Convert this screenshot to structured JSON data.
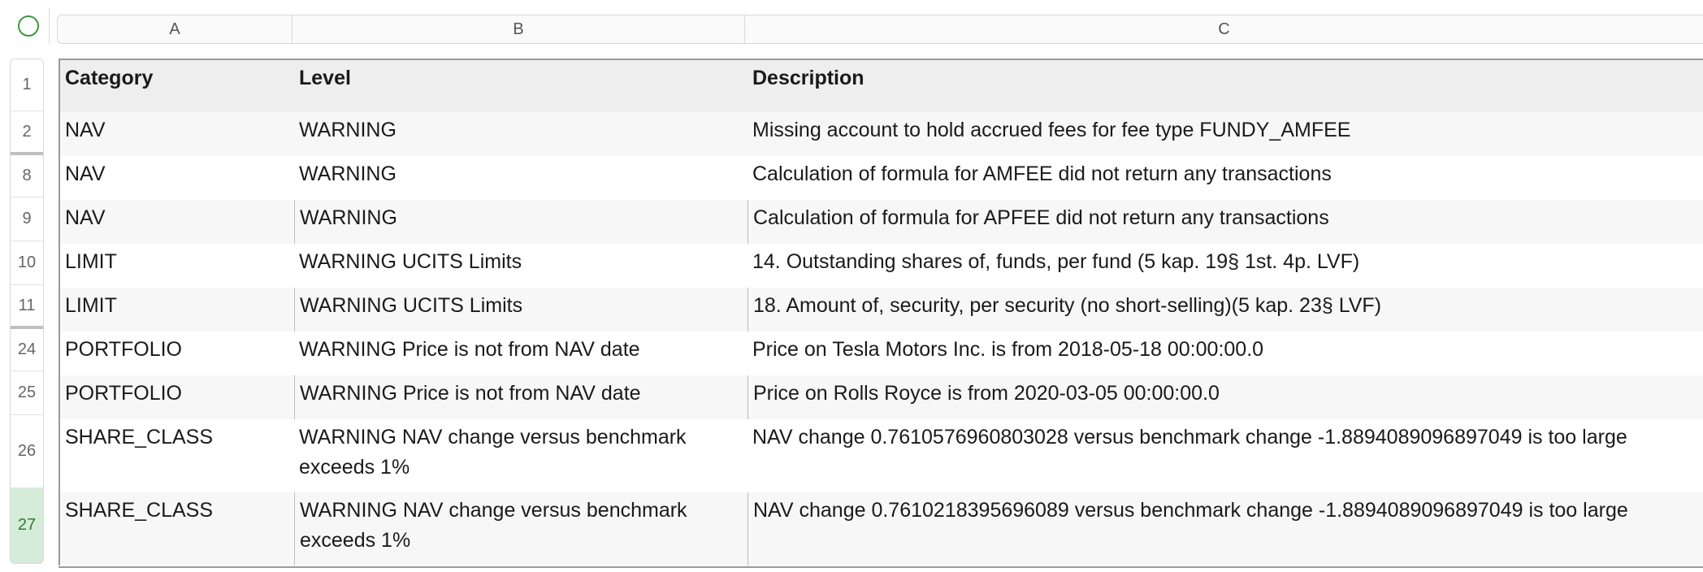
{
  "columns": [
    "A",
    "B",
    "C"
  ],
  "row_numbers": [
    "1",
    "2",
    "8",
    "9",
    "10",
    "11",
    "24",
    "25",
    "26",
    "27"
  ],
  "header": {
    "category": "Category",
    "level": "Level",
    "description": "Description"
  },
  "rows": [
    {
      "category": "NAV",
      "level": "WARNING",
      "description": "Missing account to hold accrued fees for fee type FUNDY_AMFEE"
    },
    {
      "category": "NAV",
      "level": "WARNING",
      "description": "Calculation of formula for AMFEE did not return any transactions"
    },
    {
      "category": "NAV",
      "level": "WARNING",
      "description": "Calculation of formula for APFEE did not return any transactions"
    },
    {
      "category": "LIMIT",
      "level": "WARNING UCITS Limits",
      "description": "14. Outstanding shares of, funds, per fund (5 kap. 19§ 1st. 4p. LVF)"
    },
    {
      "category": "LIMIT",
      "level": "WARNING UCITS Limits",
      "description": "18. Amount of, security, per security (no short-selling)(5 kap. 23§ LVF)"
    },
    {
      "category": "PORTFOLIO",
      "level": "WARNING Price is not from NAV date",
      "description": "Price on Tesla Motors Inc. is from 2018-05-18 00:00:00.0"
    },
    {
      "category": "PORTFOLIO",
      "level": "WARNING Price is not from NAV date",
      "description": "Price on Rolls Royce is from 2020-03-05 00:00:00.0"
    },
    {
      "category": "SHARE_CLASS",
      "level": "WARNING NAV change versus benchmark exceeds 1%",
      "description": "NAV change 0.7610576960803028 versus benchmark change -1.8894089096897049 is too large"
    },
    {
      "category": "SHARE_CLASS",
      "level": "WARNING NAV change versus benchmark exceeds 1%",
      "description": "NAV change 0.7610218395696089 versus benchmark change -1.8894089096897049 is too large"
    }
  ],
  "colors": {
    "selected_row_header_bg": "#d5ecd8",
    "select_all_circle": "#3a9a3a"
  },
  "icons": {
    "select_all": "circle-icon"
  }
}
